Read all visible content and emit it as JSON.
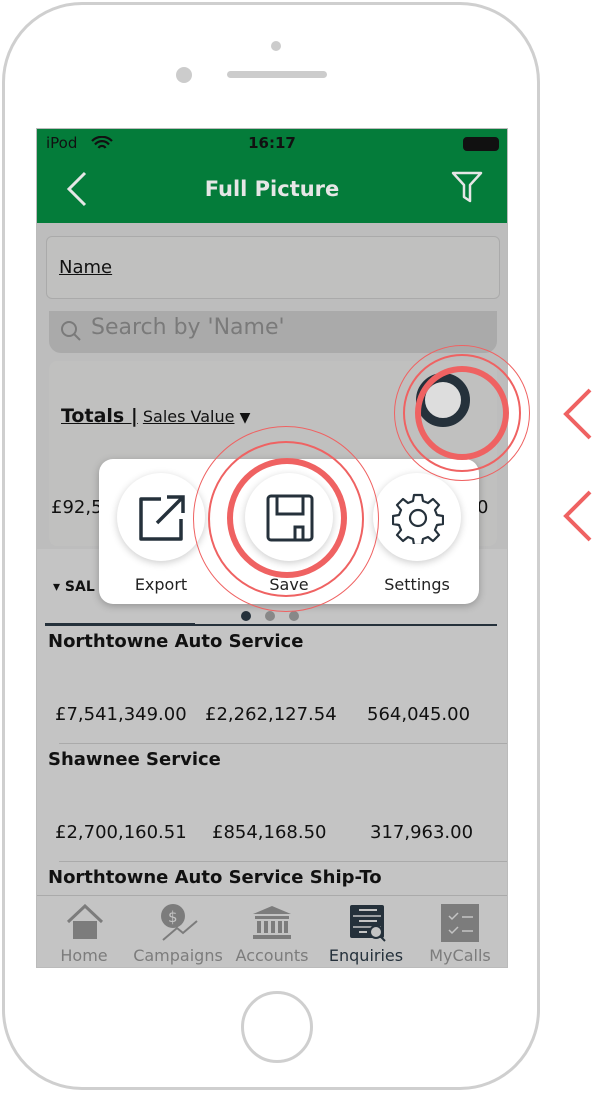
{
  "status": {
    "carrier": "iPod",
    "time": "16:17"
  },
  "nav": {
    "title": "Full Picture",
    "back_icon": "chevron-left-icon",
    "filter_icon": "filter-icon"
  },
  "name_field": {
    "label": "Name"
  },
  "search": {
    "placeholder": "Search by 'Name'"
  },
  "totals": {
    "label": "Totals |",
    "measure": "Sales Value",
    "arrow": "▼",
    "value_left": "£92,5",
    "value_right": "0"
  },
  "section": {
    "label": "SAL"
  },
  "popup": {
    "items": [
      {
        "label": "Export",
        "icon": "export-icon"
      },
      {
        "label": "Save",
        "icon": "save-icon"
      },
      {
        "label": "Settings",
        "icon": "gear-icon"
      }
    ],
    "page": 1,
    "pages": 3
  },
  "rows": [
    {
      "name": "Northtowne Auto Service",
      "values": [
        "£7,541,349.00",
        "£2,262,127.54",
        "564,045.00"
      ]
    },
    {
      "name": "Shawnee Service",
      "values": [
        "£2,700,160.51",
        "£854,168.50",
        "317,963.00"
      ]
    },
    {
      "name": "Northtowne Auto Service Ship-To"
    }
  ],
  "tabs": [
    {
      "label": "Home"
    },
    {
      "label": "Campaigns"
    },
    {
      "label": "Accounts"
    },
    {
      "label": "Enquiries",
      "active": true
    },
    {
      "label": "MyCalls"
    }
  ],
  "colors": {
    "brand": "#047c3a",
    "highlight": "#ef6262",
    "icon_dark": "#25313b"
  }
}
